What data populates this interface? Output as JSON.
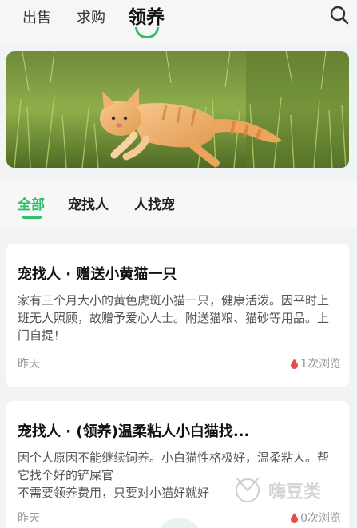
{
  "top_tabs": {
    "sell": "出售",
    "buy": "求购",
    "adopt": "领养"
  },
  "categories": {
    "all": "全部",
    "pet_finds_person": "宠找人",
    "person_finds_pet": "人找宠"
  },
  "colors": {
    "accent": "#2dbf6b",
    "view_icon": "#e84a4a"
  },
  "posts": [
    {
      "title": "宠找人 · 赠送小黄猫一只",
      "description": "家有三个月大小的黄色虎斑小猫一只，健康活泼。因平时上班无人照顾，故赠予爱心人士。附送猫粮、猫砂等用品。上门自提！",
      "date": "昨天",
      "views": "1次浏览"
    },
    {
      "title": "宠找人 · (领养)温柔粘人小白猫找...",
      "description_lines": [
        "因个人原因不能继续饲养。小白猫性格极好，温柔粘人。帮它找个好的铲屎官",
        "不需要领养费用，只要对小猫好就好"
      ],
      "date": "昨天",
      "views": "0次浏览"
    }
  ],
  "watermark": "嗨豆类"
}
